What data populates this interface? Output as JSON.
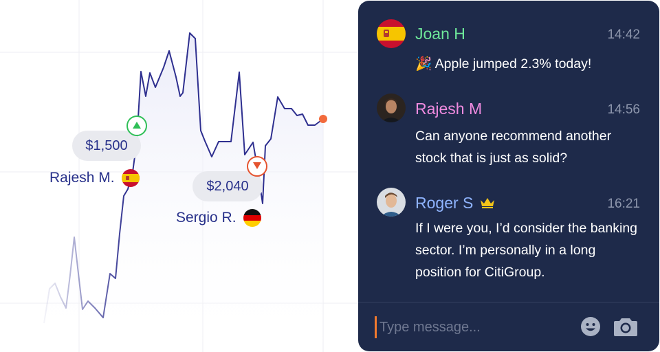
{
  "chart": {
    "trades": [
      {
        "price": "$1,500",
        "trader": "Rajesh M.",
        "flag": "spain-flag",
        "direction": "up"
      },
      {
        "price": "$2,040",
        "trader": "Sergio R.",
        "flag": "germany-flag",
        "direction": "down"
      }
    ]
  },
  "chat": {
    "messages": [
      {
        "name": "Joan H",
        "name_color": "#6ee89a",
        "time": "14:42",
        "avatar": "spain-flag-avatar",
        "emoji": "🎉",
        "text": "Apple  jumped 2.3% today!"
      },
      {
        "name": "Rajesh M",
        "name_color": "#f08be0",
        "time": "14:56",
        "avatar": "user-photo-avatar",
        "text": "Can anyone recommend another stock that is just as solid?"
      },
      {
        "name": "Roger S",
        "name_color": "#8fb4ff",
        "time": "16:21",
        "avatar": "user-photo-avatar",
        "badge": "crown-icon",
        "text": "If I were you, I’d consider the banking sector. I’m personally in a long position for CitiGroup."
      }
    ],
    "composer": {
      "placeholder": "Type message...",
      "emoji_button": "smiley-icon",
      "camera_button": "camera-icon"
    }
  },
  "colors": {
    "chart_line": "#2e2f8f",
    "panel_bg": "#1e2a4a",
    "up": "#2fbf57",
    "down": "#e5532f",
    "live_dot": "#f26a3c",
    "crown": "#f5c518"
  }
}
